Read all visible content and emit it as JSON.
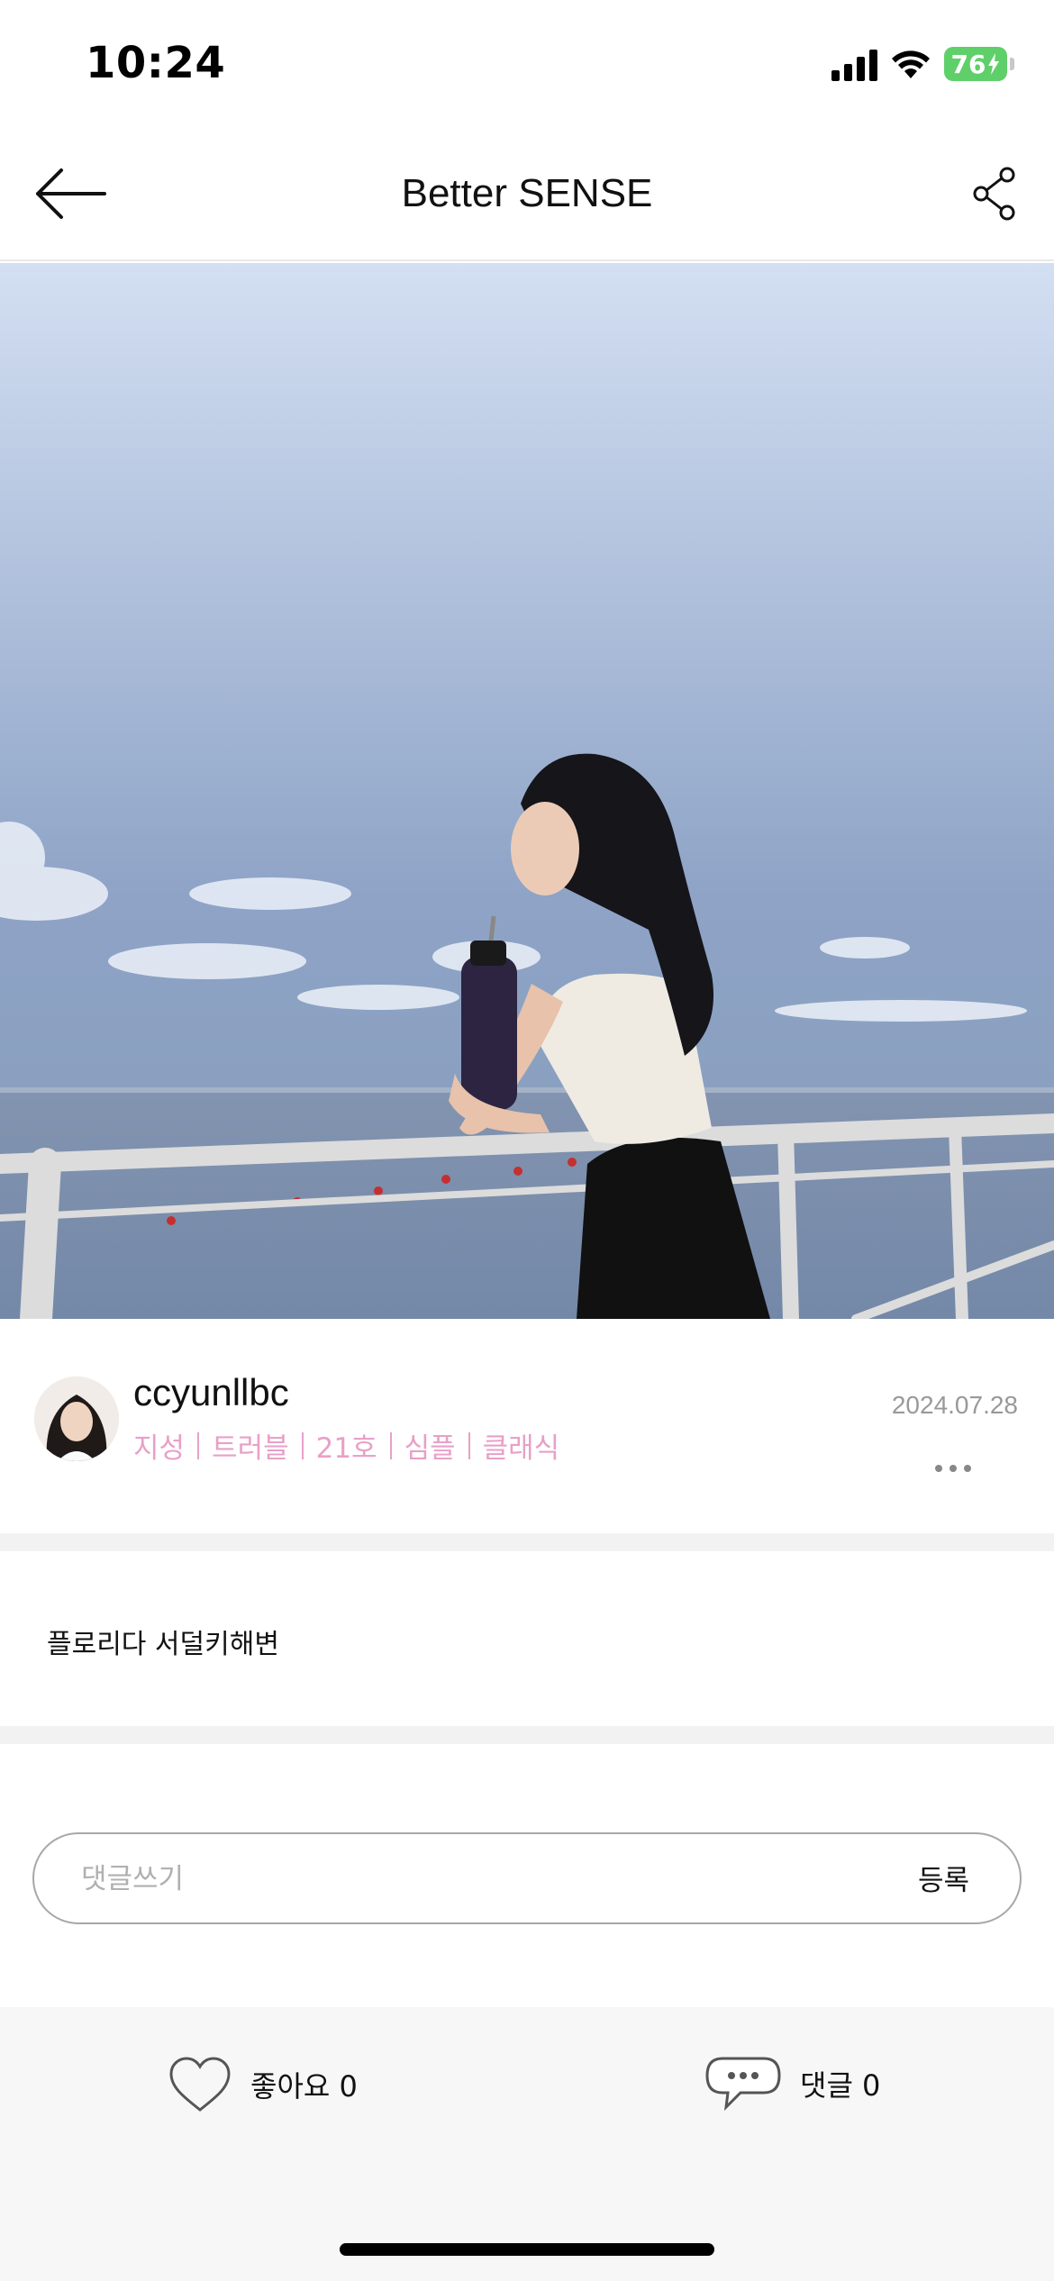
{
  "status_bar": {
    "time": "10:24",
    "battery": "76",
    "icons": [
      "signal-icon",
      "wifi-icon",
      "battery-charging-icon"
    ]
  },
  "header": {
    "title": "Better SENSE",
    "back_icon": "arrow-left-icon",
    "share_icon": "share-icon"
  },
  "post": {
    "author": {
      "username": "ccyunllbc",
      "tags": [
        "지성",
        "트러블",
        "21호",
        "심플",
        "클래식"
      ]
    },
    "date": "2024.07.28",
    "content": "플로리다 서덜키해변"
  },
  "comment_form": {
    "placeholder": "댓글쓰기",
    "value": "",
    "submit_label": "등록"
  },
  "actions": {
    "like_label": "좋아요 0",
    "comment_label": "댓글 0"
  },
  "colors": {
    "tag_pink": "#e8a0c8",
    "battery_green": "#5fcf6a",
    "divider": "#f2f2f2",
    "bottom_bar": "#f7f7f7"
  }
}
